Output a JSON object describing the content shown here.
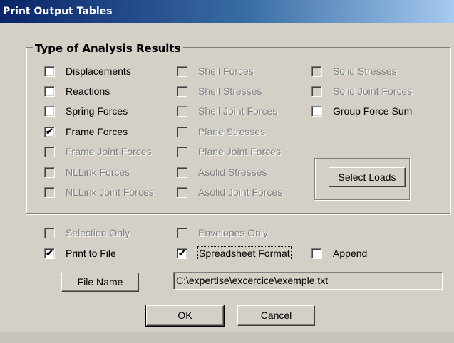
{
  "window": {
    "title": "Print Output Tables"
  },
  "results_group": {
    "legend": "Type of Analysis Results",
    "col1": [
      {
        "label": "Displacements",
        "checked": false,
        "enabled": true
      },
      {
        "label": "Reactions",
        "checked": false,
        "enabled": true
      },
      {
        "label": "Spring Forces",
        "checked": false,
        "enabled": true
      },
      {
        "label": "Frame Forces",
        "checked": true,
        "enabled": true
      },
      {
        "label": "Frame Joint Forces",
        "checked": false,
        "enabled": false
      },
      {
        "label": "NLLink Forces",
        "checked": false,
        "enabled": false
      },
      {
        "label": "NLLink Joint Forces",
        "checked": false,
        "enabled": false
      }
    ],
    "col2": [
      {
        "label": "Shell Forces",
        "checked": false,
        "enabled": false
      },
      {
        "label": "Shell Stresses",
        "checked": false,
        "enabled": false
      },
      {
        "label": "Shell Joint Forces",
        "checked": false,
        "enabled": false
      },
      {
        "label": "Plane Stresses",
        "checked": false,
        "enabled": false
      },
      {
        "label": "Plane Joint Forces",
        "checked": false,
        "enabled": false
      },
      {
        "label": "Asolid Stresses",
        "checked": false,
        "enabled": false
      },
      {
        "label": "Asolid Joint Forces",
        "checked": false,
        "enabled": false
      }
    ],
    "col3": [
      {
        "label": "Solid Stresses",
        "checked": false,
        "enabled": false
      },
      {
        "label": "Solid Joint Forces",
        "checked": false,
        "enabled": false
      },
      {
        "label": "Group Force Sum",
        "checked": false,
        "enabled": true
      }
    ],
    "select_loads_label": "Select Loads"
  },
  "options": {
    "selection_only": {
      "label": "Selection Only",
      "checked": false,
      "enabled": false
    },
    "envelopes_only": {
      "label": "Envelopes Only",
      "checked": false,
      "enabled": false
    },
    "print_to_file": {
      "label": "Print to File",
      "checked": true,
      "enabled": true
    },
    "spreadsheet_format": {
      "label": "Spreadsheet Format",
      "checked": true,
      "enabled": true
    },
    "append": {
      "label": "Append",
      "checked": false,
      "enabled": true
    }
  },
  "file": {
    "button_label": "File Name",
    "path": "C:\\expertise\\excercice\\exemple.txt"
  },
  "buttons": {
    "ok": "OK",
    "cancel": "Cancel"
  }
}
